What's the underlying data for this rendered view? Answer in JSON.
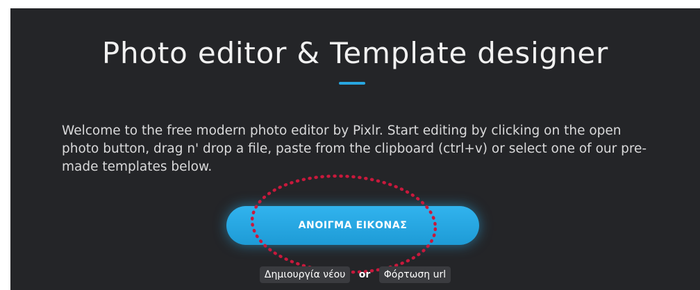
{
  "hero": {
    "title": "Photo editor & Template designer",
    "description": "Welcome to the free modern photo editor by Pixlr. Start editing by clicking on the open photo button, drag n' drop a file, paste from the clipboard (ctrl+v) or select one of our pre-made templates below.",
    "accent_color": "#28a6e0"
  },
  "actions": {
    "open_image_label": "ΑΝΟΙΓΜΑ ΕΙΚΟΝΑΣ",
    "create_new_label": "Δημιουργία νέου",
    "or_label": "or",
    "load_url_label": "Φόρτωση url"
  },
  "annotation": {
    "color": "#c8193c",
    "style": "dotted-ellipse"
  }
}
